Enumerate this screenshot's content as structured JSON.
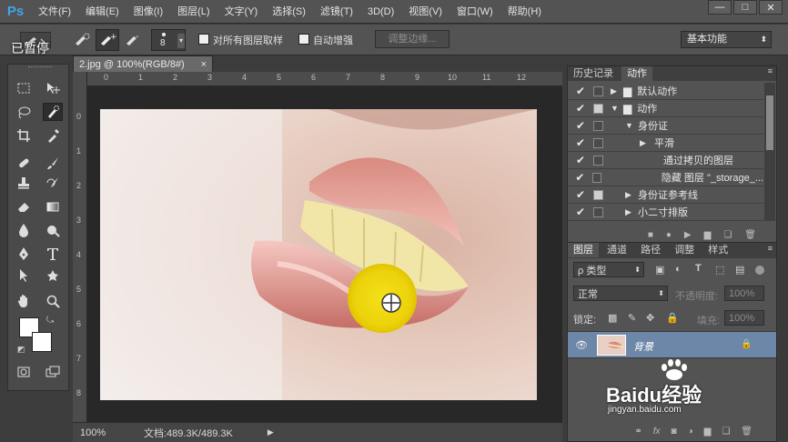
{
  "menubar": {
    "logo": "Ps",
    "items": [
      "文件(F)",
      "编辑(E)",
      "图像(I)",
      "图层(L)",
      "文字(Y)",
      "选择(S)",
      "滤镜(T)",
      "3D(D)",
      "视图(V)",
      "窗口(W)",
      "帮助(H)"
    ],
    "window_buttons": [
      "—",
      "□",
      "✕"
    ]
  },
  "options": {
    "brush_size": "8",
    "sample_all_layers": "对所有图层取样",
    "auto_enhance": "自动增强",
    "refine_edge": "调整边缘...",
    "workspace": "基本功能"
  },
  "overlay": {
    "paused": "已暂停"
  },
  "document": {
    "tab_title": "2.jpg @ 100%(RGB/8#)",
    "tab_close": "×",
    "zoom": "100%",
    "doc_info": "文档:489.3K/489.3K",
    "ruler_top": [
      "0",
      "1",
      "2",
      "3",
      "4",
      "5",
      "6",
      "7",
      "8",
      "9",
      "10",
      "11",
      "12"
    ],
    "ruler_left": [
      "0",
      "1",
      "2",
      "3",
      "4",
      "5",
      "6",
      "7",
      "8"
    ]
  },
  "actions_panel": {
    "tabs": [
      "历史记录",
      "动作"
    ],
    "rows": [
      {
        "label": "默认动作",
        "level": 0,
        "expanded": false,
        "folder": true,
        "checked": true,
        "dialog": false
      },
      {
        "label": "动作",
        "level": 0,
        "expanded": true,
        "folder": true,
        "checked": true,
        "dialog": true
      },
      {
        "label": "身份证",
        "level": 1,
        "expanded": true,
        "folder": false,
        "checked": true,
        "dialog": false
      },
      {
        "label": "平滑",
        "level": 2,
        "expanded": false,
        "folder": false,
        "checked": true,
        "dialog": false
      },
      {
        "label": "通过拷贝的图层",
        "level": 3,
        "expanded": false,
        "folder": false,
        "checked": true,
        "dialog": false
      },
      {
        "label": "隐藏 图层 \"_storage_...",
        "level": 3,
        "expanded": false,
        "folder": false,
        "checked": true,
        "dialog": false
      },
      {
        "label": "身份证参考线",
        "level": 1,
        "expanded": false,
        "folder": false,
        "checked": true,
        "dialog": true
      },
      {
        "label": "小二寸排版",
        "level": 1,
        "expanded": false,
        "folder": false,
        "checked": true,
        "dialog": false
      }
    ]
  },
  "layers_panel": {
    "tabs": [
      "图层",
      "通道",
      "路径",
      "调整",
      "样式"
    ],
    "filter": "ρ 类型",
    "blend_mode": "正常",
    "opacity_label": "不透明度:",
    "opacity_value": "100%",
    "lock_label": "锁定:",
    "fill_label": "填充:",
    "fill_value": "100%",
    "layer_name": "背景"
  },
  "watermark": {
    "brand": "Baidu经验",
    "url": "jingyan.baidu.com"
  },
  "colors": {
    "accent": "#3fa6e8",
    "layer_selected": "#6d87a8",
    "cursor_yellow": "#f2d90a"
  }
}
